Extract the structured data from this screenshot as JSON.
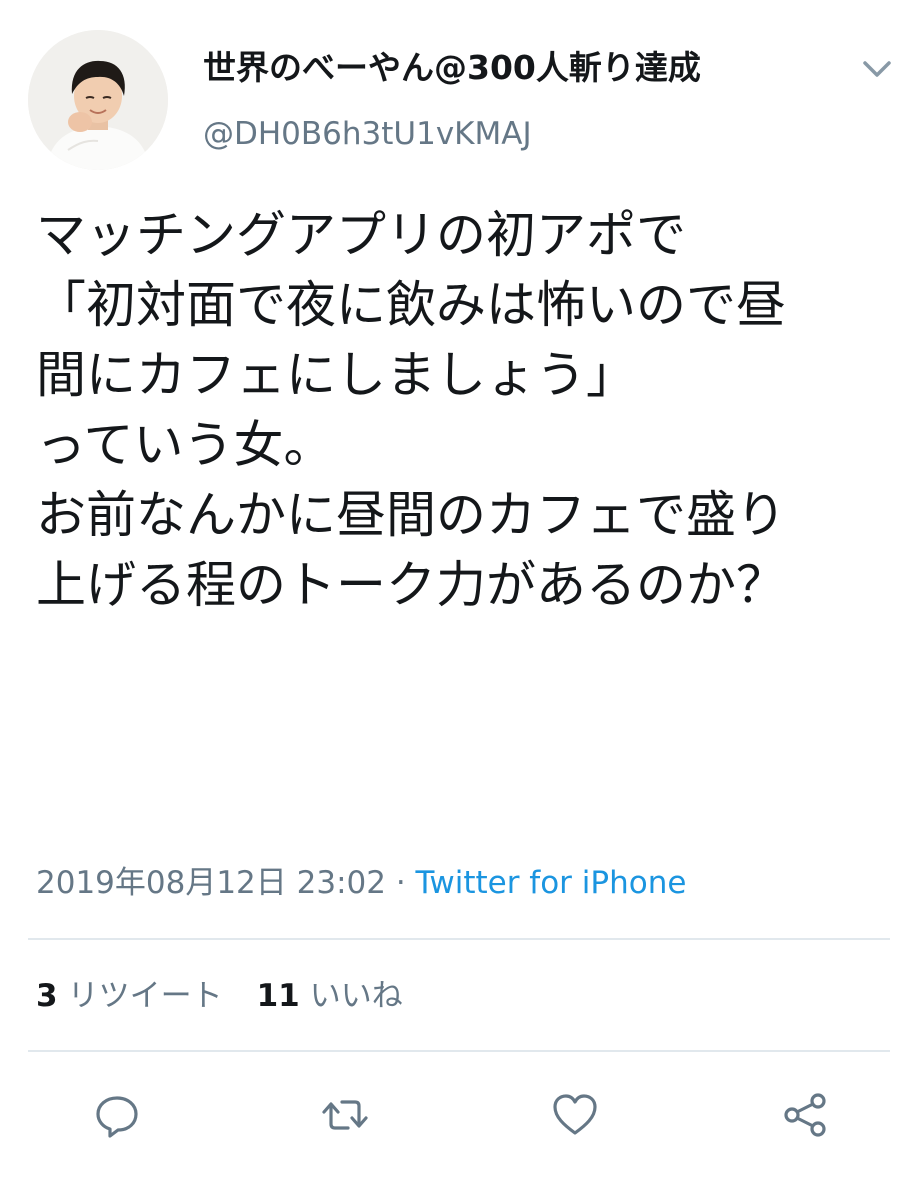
{
  "author": {
    "name": "世界のべーやん@300人斬り達成",
    "handle": "@DH0B6h3tU1vKMAJ",
    "avatar_icon": "user-photo-avatar"
  },
  "tweet": {
    "lines": [
      "マッチングアプリの初アポで",
      "",
      "「初対面で夜に飲みは怖いので昼",
      "間にカフェにしましょう」",
      "",
      "っていう女。",
      "",
      "お前なんかに昼間のカフェで盛り",
      "上げる程のトーク力があるのか？"
    ]
  },
  "meta": {
    "timestamp": "2019年08月12日 23:02",
    "separator": " · ",
    "source": "Twitter for iPhone"
  },
  "stats": {
    "retweets_count": "3",
    "retweets_label": "リツイート",
    "likes_count": "11",
    "likes_label": "いいね"
  },
  "actions": {
    "reply_icon": "reply-icon",
    "retweet_icon": "retweet-icon",
    "like_icon": "heart-icon",
    "share_icon": "share-icon"
  },
  "colors": {
    "text": "#14171a",
    "secondary": "#657786",
    "link": "#1b95e0",
    "divider": "#e1e8ed"
  }
}
